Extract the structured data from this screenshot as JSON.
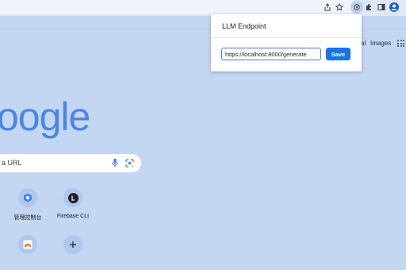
{
  "header": {
    "links": [
      "al",
      "Images"
    ]
  },
  "logo": {
    "text": "oogle"
  },
  "search": {
    "placeholder": "a URL"
  },
  "shortcuts": [
    {
      "label": "管理控制台",
      "icon": "console-icon"
    },
    {
      "label": "Firebase CLI",
      "icon": "firebase-cli-icon"
    },
    {
      "label": "",
      "icon": "rainbow-app-icon"
    },
    {
      "label": "",
      "icon": "add-shortcut-icon"
    }
  ],
  "popup": {
    "title": "LLM Endpoint",
    "input_value": "https://localhost:8000/generate",
    "save_label": "Save"
  },
  "toolbar_icons": [
    "share-icon",
    "bookmark-star-icon",
    "llm-extension-icon",
    "extensions-puzzle-icon",
    "side-panel-icon",
    "profile-avatar-icon"
  ],
  "colors": {
    "page_background": "#c3d6f2",
    "accent": "#1a73e8",
    "logo_blue": "#4a86e3"
  }
}
